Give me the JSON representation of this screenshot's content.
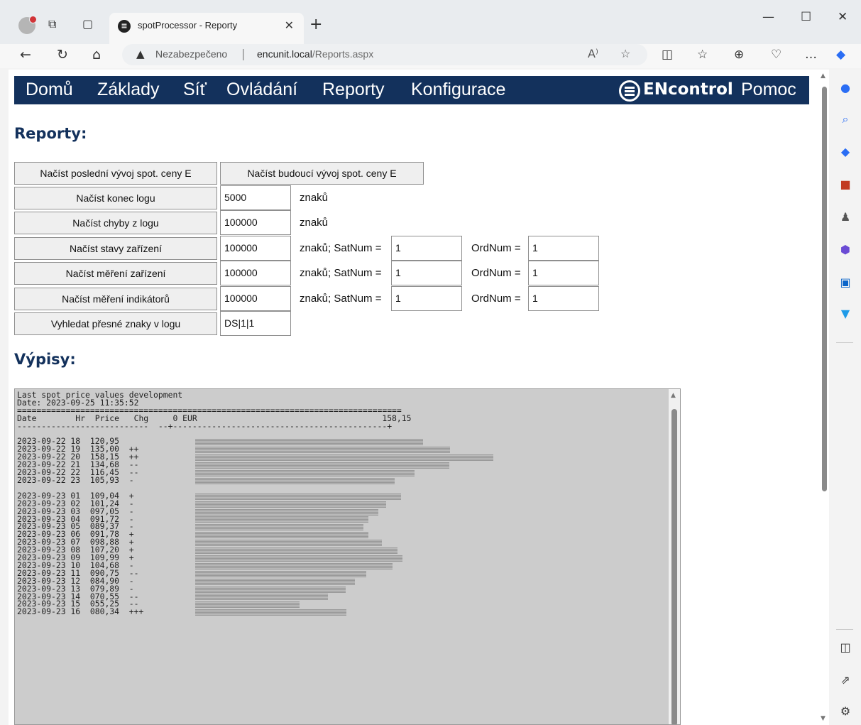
{
  "browser": {
    "tab_title": "spotProcessor - Reporty",
    "url_security": "Nezabezpečeno",
    "url_host": "encunit.local",
    "url_path": "/Reports.aspx"
  },
  "nav": {
    "items": [
      "Domů",
      "Základy",
      "Síť",
      "Ovládání",
      "Reporty",
      "Konfigurace"
    ],
    "brand": "ENcontrol",
    "help": "Pomoc"
  },
  "reports": {
    "heading": "Reporty:",
    "btn_last_spot": "Načíst poslední vývoj spot. ceny E",
    "btn_future_spot": "Načíst budoucí vývoj spot. ceny E",
    "rows": [
      {
        "button": "Načíst konec logu",
        "value": "5000",
        "unit": "znaků"
      },
      {
        "button": "Načíst chyby z logu",
        "value": "100000",
        "unit": "znaků"
      },
      {
        "button": "Načíst stavy zařízení",
        "value": "100000",
        "unit": "znaků; SatNum =",
        "sat": "1",
        "ord_label": "OrdNum =",
        "ord": "1"
      },
      {
        "button": "Načíst měření zařízení",
        "value": "100000",
        "unit": "znaků; SatNum =",
        "sat": "1",
        "ord_label": "OrdNum =",
        "ord": "1"
      },
      {
        "button": "Načíst měření indikátorů",
        "value": "100000",
        "unit": "znaků; SatNum =",
        "sat": "1",
        "ord_label": "OrdNum =",
        "ord": "1"
      },
      {
        "button": "Vyhledat přesné znaky v logu",
        "value": "DS|1|1"
      }
    ]
  },
  "listing": {
    "heading": "Výpisy:",
    "title": "Last spot price values development",
    "date_line": "Date: 2023-09-25 11:35:52",
    "sep": "===============================================================================",
    "col_header": "Date        Hr  Price   Chg     0 EUR                                      158,15",
    "col_rule": "---------------------------  --+--------------------------------------------+",
    "max_value": 158.15,
    "rows": [
      {
        "date": "2023-09-22",
        "hr": "18",
        "price": "120,95",
        "chg": ""
      },
      {
        "date": "2023-09-22",
        "hr": "19",
        "price": "135,00",
        "chg": "++"
      },
      {
        "date": "2023-09-22",
        "hr": "20",
        "price": "158,15",
        "chg": "++"
      },
      {
        "date": "2023-09-22",
        "hr": "21",
        "price": "134,68",
        "chg": "--"
      },
      {
        "date": "2023-09-22",
        "hr": "22",
        "price": "116,45",
        "chg": "--"
      },
      {
        "date": "2023-09-22",
        "hr": "23",
        "price": "105,93",
        "chg": "-"
      },
      {
        "blank": true
      },
      {
        "date": "2023-09-23",
        "hr": "01",
        "price": "109,04",
        "chg": "+"
      },
      {
        "date": "2023-09-23",
        "hr": "02",
        "price": "101,24",
        "chg": "-"
      },
      {
        "date": "2023-09-23",
        "hr": "03",
        "price": "097,05",
        "chg": "-"
      },
      {
        "date": "2023-09-23",
        "hr": "04",
        "price": "091,72",
        "chg": "-"
      },
      {
        "date": "2023-09-23",
        "hr": "05",
        "price": "089,37",
        "chg": "-"
      },
      {
        "date": "2023-09-23",
        "hr": "06",
        "price": "091,78",
        "chg": "+"
      },
      {
        "date": "2023-09-23",
        "hr": "07",
        "price": "098,88",
        "chg": "+"
      },
      {
        "date": "2023-09-23",
        "hr": "08",
        "price": "107,20",
        "chg": "+"
      },
      {
        "date": "2023-09-23",
        "hr": "09",
        "price": "109,99",
        "chg": "+"
      },
      {
        "date": "2023-09-23",
        "hr": "10",
        "price": "104,68",
        "chg": "-"
      },
      {
        "date": "2023-09-23",
        "hr": "11",
        "price": "090,75",
        "chg": "--"
      },
      {
        "date": "2023-09-23",
        "hr": "12",
        "price": "084,90",
        "chg": "-"
      },
      {
        "date": "2023-09-23",
        "hr": "13",
        "price": "079,89",
        "chg": "-"
      },
      {
        "date": "2023-09-23",
        "hr": "14",
        "price": "070,55",
        "chg": "--"
      },
      {
        "date": "2023-09-23",
        "hr": "15",
        "price": "055,25",
        "chg": "--"
      },
      {
        "date": "2023-09-23",
        "hr": "16",
        "price": "080,34",
        "chg": "+++"
      }
    ]
  }
}
